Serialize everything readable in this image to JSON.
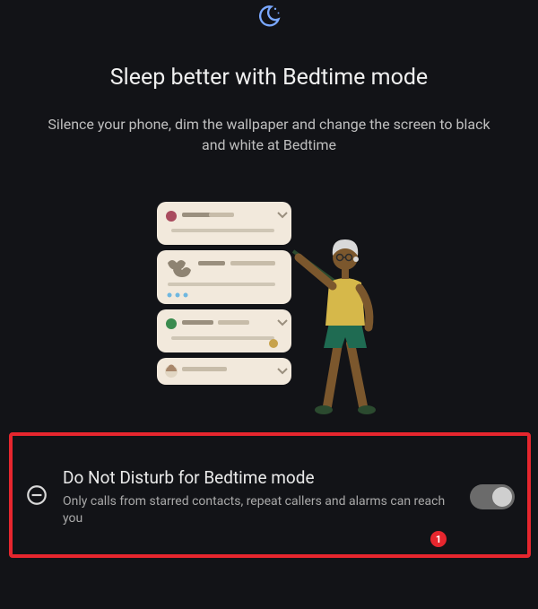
{
  "header": {
    "icon": "moon-stars-icon"
  },
  "page": {
    "title": "Sleep better with Bedtime mode",
    "subtitle": "Silence your phone, dim the wallpaper and change the screen to black and white at Bedtime"
  },
  "setting": {
    "icon": "do-not-disturb-icon",
    "title": "Do Not Disturb for Bedtime mode",
    "description": "Only calls from starred contacts, repeat callers and alarms can reach you",
    "toggle_state": "on"
  },
  "annotation": {
    "badge": "1"
  },
  "colors": {
    "highlight": "#e6262e",
    "accent_moon": "#7aa8ff"
  }
}
